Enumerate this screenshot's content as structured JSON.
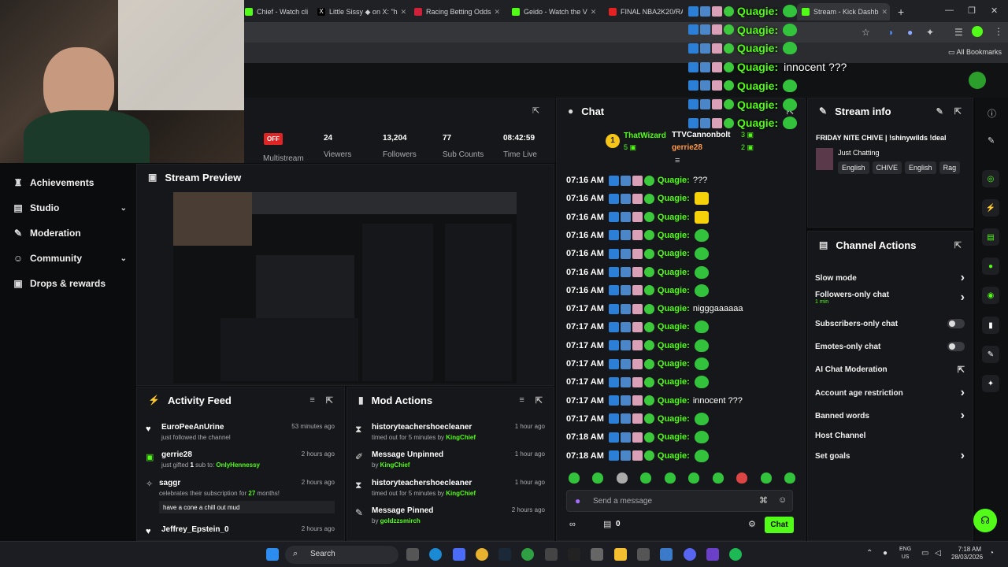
{
  "browser": {
    "tabs": [
      {
        "label": "Chief - Watch cli",
        "color": "#53fc18"
      },
      {
        "label": "Little Sissy ◆ on X: \"h",
        "color": "#111"
      },
      {
        "label": "Racing Betting Odds",
        "color": "#d0213b"
      },
      {
        "label": "Geido - Watch the V",
        "color": "#53fc18"
      },
      {
        "label": "FINAL NBA2K20/RAG",
        "color": "#e52222"
      },
      {
        "label": "Stream - Kick Dashb",
        "color": "#53fc18"
      }
    ],
    "bookmarks_label": "All Bookmarks"
  },
  "overlay_chat": [
    {
      "user": "Quagie:",
      "text": ""
    },
    {
      "user": "Quagie:",
      "text": ""
    },
    {
      "user": "Quagie:",
      "text": ""
    },
    {
      "user": "Quagie:",
      "text": "innocent ???"
    },
    {
      "user": "Quagie:",
      "text": ""
    },
    {
      "user": "Quagie:",
      "text": ""
    },
    {
      "user": "Quagie:",
      "text": ""
    }
  ],
  "nav": {
    "items": [
      {
        "label": "Achievements",
        "icon": "trophy-icon"
      },
      {
        "label": "Studio",
        "icon": "studio-icon"
      },
      {
        "label": "Moderation",
        "icon": "wrench-icon"
      },
      {
        "label": "Community",
        "icon": "community-icon"
      },
      {
        "label": "Drops & rewards",
        "icon": "gift-icon"
      }
    ]
  },
  "stats": {
    "badge": "OFF",
    "multistream_label": "Multistream",
    "viewers": "24",
    "viewers_label": "Viewers",
    "followers": "13,204",
    "followers_label": "Followers",
    "subs": "77",
    "subs_label": "Sub Counts",
    "time": "08:42:59",
    "time_label": "Time Live"
  },
  "preview": {
    "title": "Stream Preview"
  },
  "chat": {
    "title": "Chat",
    "leader1": {
      "rank": "1",
      "name": "ThatWizard",
      "count": "5"
    },
    "leader2": {
      "name": "TTVCannonbolt",
      "count": "3"
    },
    "leader3": {
      "name": "gerrie28",
      "count": "2"
    },
    "messages": [
      {
        "time": "07:16 AM",
        "user": "Quagie:",
        "text": "???",
        "emote": ""
      },
      {
        "time": "07:16 AM",
        "user": "Quagie:",
        "text": "",
        "emote": "y"
      },
      {
        "time": "07:16 AM",
        "user": "Quagie:",
        "text": "",
        "emote": "y"
      },
      {
        "time": "07:16 AM",
        "user": "Quagie:",
        "text": "",
        "emote": "g"
      },
      {
        "time": "07:16 AM",
        "user": "Quagie:",
        "text": "",
        "emote": "g"
      },
      {
        "time": "07:16 AM",
        "user": "Quagie:",
        "text": "",
        "emote": "g"
      },
      {
        "time": "07:16 AM",
        "user": "Quagie:",
        "text": "",
        "emote": "g"
      },
      {
        "time": "07:17 AM",
        "user": "Quagie:",
        "text": "nigggaaaaaa",
        "emote": ""
      },
      {
        "time": "07:17 AM",
        "user": "Quagie:",
        "text": "",
        "emote": "g"
      },
      {
        "time": "07:17 AM",
        "user": "Quagie:",
        "text": "",
        "emote": "g"
      },
      {
        "time": "07:17 AM",
        "user": "Quagie:",
        "text": "",
        "emote": "g"
      },
      {
        "time": "07:17 AM",
        "user": "Quagie:",
        "text": "",
        "emote": "g"
      },
      {
        "time": "07:17 AM",
        "user": "Quagie:",
        "text": "innocent ???",
        "emote": ""
      },
      {
        "time": "07:17 AM",
        "user": "Quagie:",
        "text": "",
        "emote": "g"
      },
      {
        "time": "07:18 AM",
        "user": "Quagie:",
        "text": "",
        "emote": "g"
      },
      {
        "time": "07:18 AM",
        "user": "Quagie:",
        "text": "",
        "emote": "g"
      }
    ],
    "placeholder": "Send a message",
    "points": "0",
    "send_label": "Chat"
  },
  "stream_info": {
    "title_label": "Stream info",
    "stream_title": "FRIDAY NITE CHIVE | !shinywilds !deal",
    "category": "Just Chatting",
    "tags": [
      "English",
      "CHIVE",
      "English",
      "Rag"
    ]
  },
  "channel_actions": {
    "title": "Channel Actions",
    "items": [
      {
        "label": "Slow mode",
        "sub": "",
        "ctrl": "arrow"
      },
      {
        "label": "Followers-only chat",
        "sub": "1 min",
        "ctrl": "arrow"
      },
      {
        "label": "Subscribers-only chat",
        "sub": "",
        "ctrl": "toggle"
      },
      {
        "label": "Emotes-only chat",
        "sub": "",
        "ctrl": "toggle"
      },
      {
        "label": "AI Chat Moderation",
        "sub": "",
        "ctrl": "ext"
      },
      {
        "label": "Account age restriction",
        "sub": "",
        "ctrl": "arrow"
      },
      {
        "label": "Banned words",
        "sub": "",
        "ctrl": "arrow"
      },
      {
        "label": "Host Channel",
        "sub": "",
        "ctrl": "none"
      },
      {
        "label": "Set goals",
        "sub": "",
        "ctrl": "arrow"
      }
    ]
  },
  "activity": {
    "title": "Activity Feed",
    "items": [
      {
        "name": "EuroPeeAnUrine",
        "sub": "just followed the channel",
        "time": "53 minutes ago"
      },
      {
        "name": "gerrie28",
        "sub_pre": "just gifted ",
        "sub_num": "1",
        "sub_mid": " sub to: ",
        "sub_user": "OnlyHennessy",
        "time": "2 hours ago"
      },
      {
        "name": "saggr",
        "sub_pre": "celebrates their subscription for ",
        "sub_num": "27",
        "sub_mid": " months!",
        "msg": "have a cone a chill out mud",
        "time": "2 hours ago"
      },
      {
        "name": "Jeffrey_Epstein_0",
        "time": "2 hours ago"
      }
    ]
  },
  "mod": {
    "title": "Mod Actions",
    "items": [
      {
        "name": "historyteachershoecleaner",
        "sub_pre": "timed out for 5 minutes by ",
        "by": "KingChief",
        "time": "1 hour ago"
      },
      {
        "name": "Message Unpinned",
        "sub_pre": "by ",
        "by": "KingChief",
        "time": "1 hour ago"
      },
      {
        "name": "historyteachershoecleaner",
        "sub_pre": "timed out for 5 minutes by ",
        "by": "KingChief",
        "time": "1 hour ago"
      },
      {
        "name": "Message Pinned",
        "sub_pre": "by ",
        "by": "goldzzsmirch",
        "time": "2 hours ago"
      }
    ]
  },
  "taskbar": {
    "search": "Search",
    "lang1": "ENG",
    "lang2": "US",
    "time": "7:18 AM",
    "date": "28/03/2026"
  }
}
